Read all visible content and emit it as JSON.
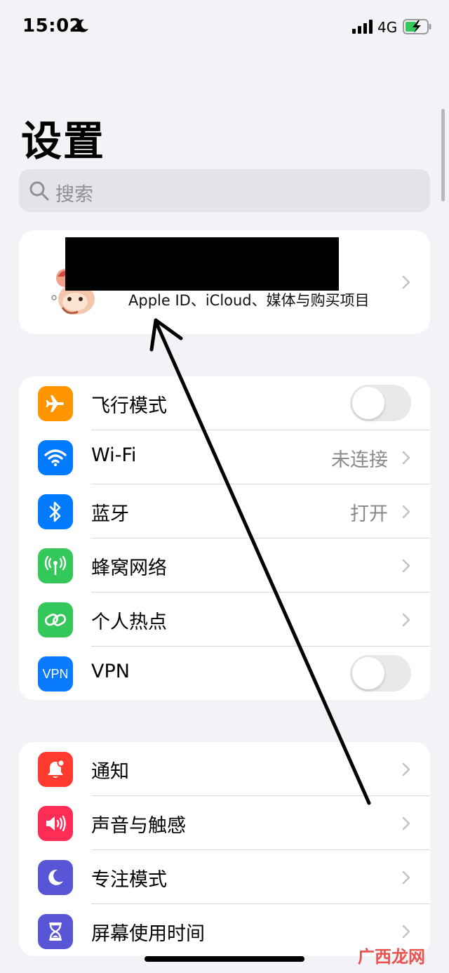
{
  "status_bar": {
    "time": "15:02",
    "network": "4G"
  },
  "page_title": "设置",
  "search": {
    "placeholder": "搜索"
  },
  "profile": {
    "subtitle": "Apple ID、iCloud、媒体与购买项目"
  },
  "group1": [
    {
      "label": "飞行模式",
      "type": "toggle",
      "on": false,
      "icon": "airplane-icon",
      "color": "#ff9500"
    },
    {
      "label": "Wi-Fi",
      "value": "未连接",
      "type": "chevron",
      "icon": "wifi-icon",
      "color": "#007aff"
    },
    {
      "label": "蓝牙",
      "value": "打开",
      "type": "chevron",
      "icon": "bluetooth-icon",
      "color": "#007aff"
    },
    {
      "label": "蜂窝网络",
      "type": "chevron",
      "icon": "cellular-icon",
      "color": "#34c759"
    },
    {
      "label": "个人热点",
      "type": "chevron",
      "icon": "hotspot-icon",
      "color": "#34c759"
    },
    {
      "label": "VPN",
      "type": "toggle",
      "on": false,
      "icon": "vpn-icon",
      "icon_text": "VPN",
      "color": "#0a7aff"
    }
  ],
  "group2": [
    {
      "label": "通知",
      "type": "chevron",
      "icon": "notifications-icon",
      "color": "#ff3b30"
    },
    {
      "label": "声音与触感",
      "type": "chevron",
      "icon": "sound-icon",
      "color": "#ff2d55"
    },
    {
      "label": "专注模式",
      "type": "chevron",
      "icon": "focus-moon-icon",
      "color": "#5856d6"
    },
    {
      "label": "屏幕使用时间",
      "type": "chevron",
      "icon": "hourglass-icon",
      "color": "#5856d6"
    }
  ],
  "watermark": "广西龙网"
}
